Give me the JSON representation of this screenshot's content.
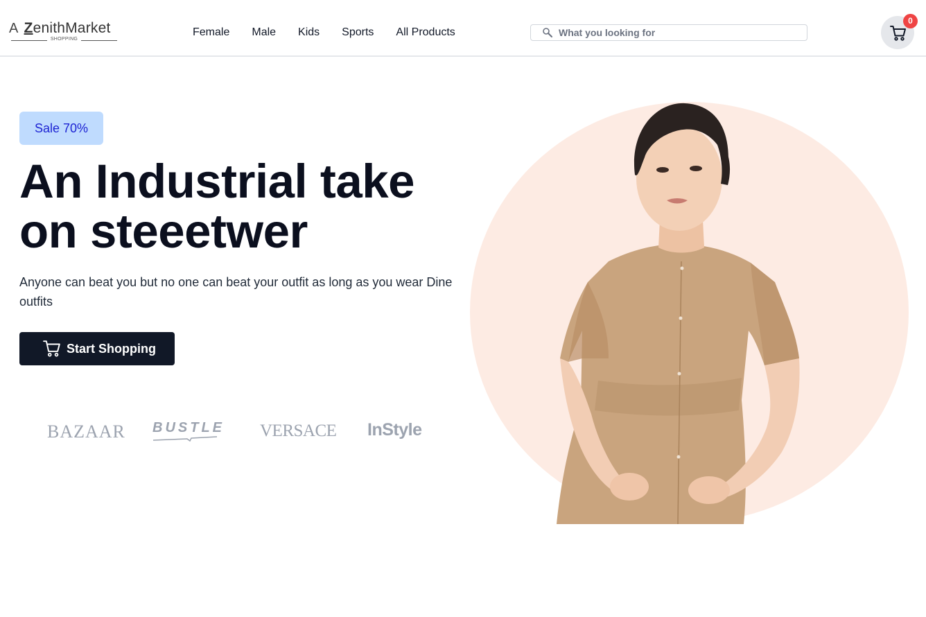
{
  "header": {
    "logo": {
      "prefix": "A",
      "initial": "Z",
      "name": "enithMarket",
      "tagline": "SHOPPING"
    },
    "nav": [
      {
        "label": "Female"
      },
      {
        "label": "Male"
      },
      {
        "label": "Kids"
      },
      {
        "label": "Sports"
      },
      {
        "label": "All Products"
      }
    ],
    "search": {
      "placeholder": "What you looking for",
      "icon": "search-icon"
    },
    "cart": {
      "icon": "cart-icon",
      "count": "0"
    }
  },
  "hero": {
    "badge": "Sale 70%",
    "title": "An Industrial take on steeetwer",
    "description": "Anyone can beat you but no one can beat your outfit as long as you wear Dine outfits",
    "cta": {
      "label": "Start Shopping",
      "icon": "cart-icon"
    },
    "brands": [
      {
        "name": "BAZAAR"
      },
      {
        "name": "BUSTLE"
      },
      {
        "name": "VERSACE"
      },
      {
        "name": "InStyle"
      }
    ]
  },
  "colors": {
    "badge_bg": "#bfdbfe",
    "badge_text": "#1d23d3",
    "cta_bg": "#111827",
    "circle_bg": "#fdebe3",
    "cart_badge": "#ef4444"
  }
}
